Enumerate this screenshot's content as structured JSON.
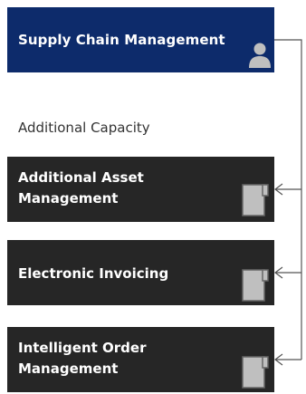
{
  "root": {
    "title": "Supply Chain Management",
    "color": "#0d2b6b",
    "icon": "person-icon"
  },
  "section_label": "Additional Capacity",
  "children": [
    {
      "title_line1": "Additional Asset",
      "title_line2": "Management",
      "icon": "document-icon"
    },
    {
      "title_line1": "Electronic Invoicing",
      "title_line2": "",
      "icon": "document-icon"
    },
    {
      "title_line1": "Intelligent Order",
      "title_line2": "Management",
      "icon": "document-icon"
    }
  ],
  "colors": {
    "child_box": "#262626",
    "connector": "#555555",
    "icon_fill": "#bfbfbf",
    "icon_outline": "#666666"
  }
}
